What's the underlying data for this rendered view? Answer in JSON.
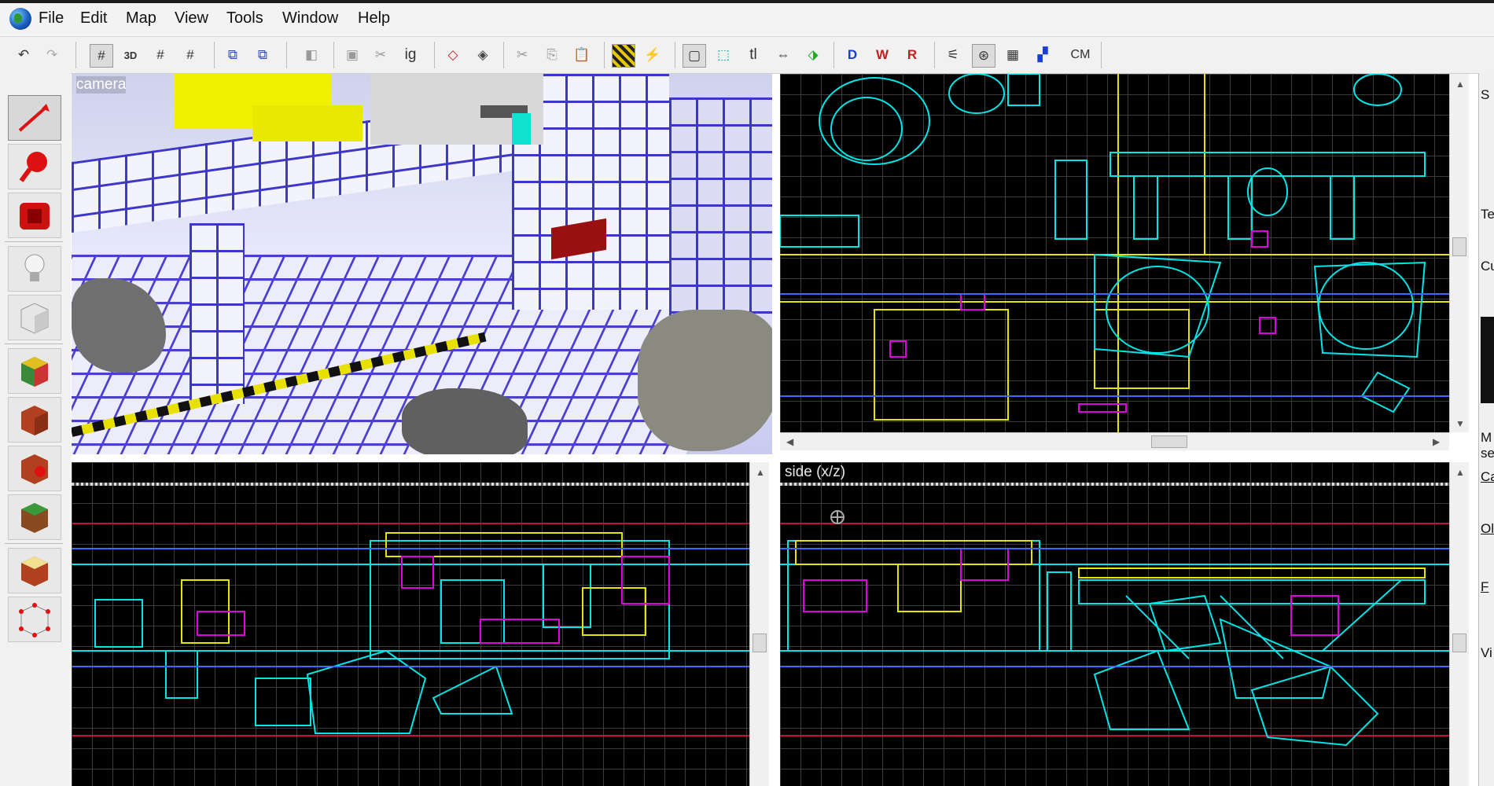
{
  "menu": {
    "items": [
      "File",
      "Edit",
      "Map",
      "View",
      "Tools",
      "Window",
      "Help"
    ]
  },
  "toolbar": {
    "ig_label": "ig",
    "tl_label": "tl",
    "cm_label": "CM"
  },
  "viewports": {
    "camera_label": "camera",
    "side_label": "side (x/z)"
  },
  "right_panel": {
    "fragments": [
      "S",
      "Te",
      "Cu",
      "M",
      "se",
      "Ca",
      "Ol",
      "F",
      "Vi"
    ]
  },
  "icons": [
    "app-globe-icon",
    "undo-icon",
    "redo-icon",
    "grid-icon",
    "3d-grid-icon",
    "select-arrow-icon",
    "magnify-icon",
    "camera-icon",
    "light-icon",
    "entity-cube-icon",
    "texture-cube-icon",
    "brick-cube-icon",
    "vertex-edit-icon"
  ],
  "colors": {
    "viewport_bg": "#000000",
    "brush_cyan": "#00e5e5",
    "brush_yellow": "#e5e500",
    "brush_magenta": "#e000e0",
    "camera_grid": "#3c37c8"
  }
}
